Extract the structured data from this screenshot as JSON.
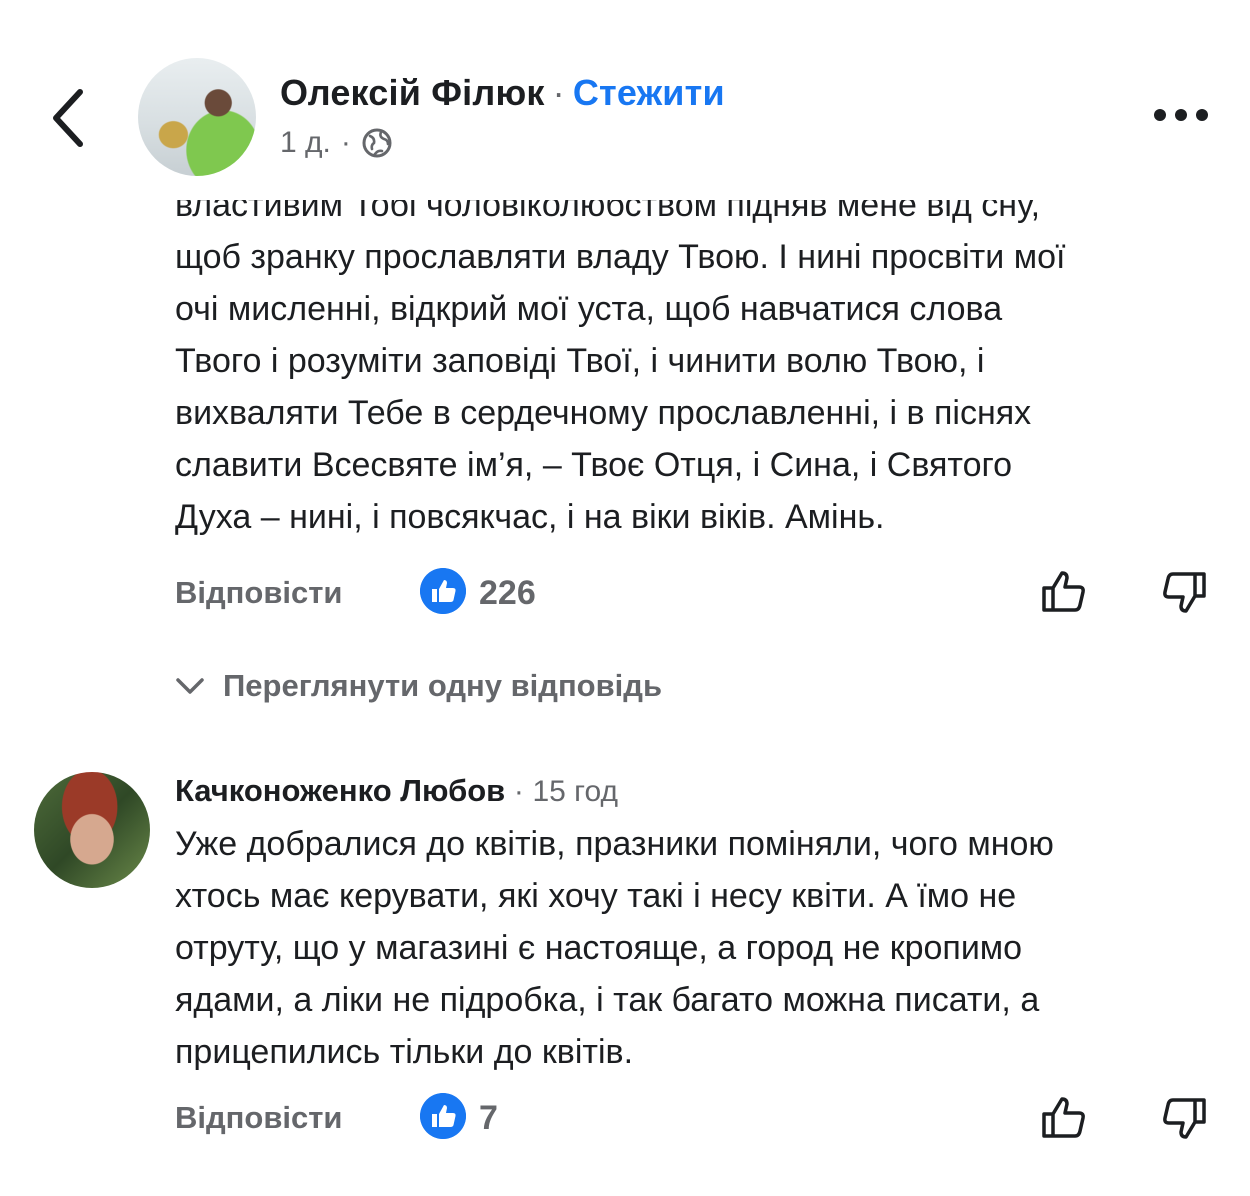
{
  "header": {
    "author": "Олексій Філюк",
    "separator": "·",
    "follow_label": "Стежити",
    "time": "1 д.",
    "meta_dot": "·",
    "visibility_icon": "globe-icon",
    "back_icon": "chevron-left-icon",
    "more_icon": "more-horizontal-icon"
  },
  "comment1": {
    "text": "властивим Тобі чоловіколюбством підняв мене від сну,\nщоб зранку прославляти владу Твою. І нині просвіти мої\nочі мисленні, відкрий мої уста, щоб навчатися слова\nТвого і розуміти заповіді Твої, і чинити волю Твою, і\nвихваляти Тебе в сердечному прославленні, і в піснях\nславити Всесвяте ім’я, – Твоє Отця, і Сина, і Святого\nДуха – нині, і повсякчас, і на віки віків. Амінь.",
    "reply_label": "Відповісти",
    "likes": "226"
  },
  "view_replies": "Переглянути одну відповідь",
  "comment2": {
    "author": "Качконоженко Любов",
    "separator": "·",
    "time": "15 год",
    "text": "Уже добралися до квітів, празники поміняли, чого мною\nхтось має керувати, які хочу такі і несу квіти. А їмо не\nотруту, що у магазині є настояще, а город не  кропимо\nядами, а ліки не підробка, і так багато можна писати, а\nприцепились тільки до квітів.",
    "reply_label": "Відповісти",
    "likes": "7"
  },
  "colors": {
    "accent": "#1877f2",
    "muted": "#65676b",
    "text": "#1c1e21"
  }
}
